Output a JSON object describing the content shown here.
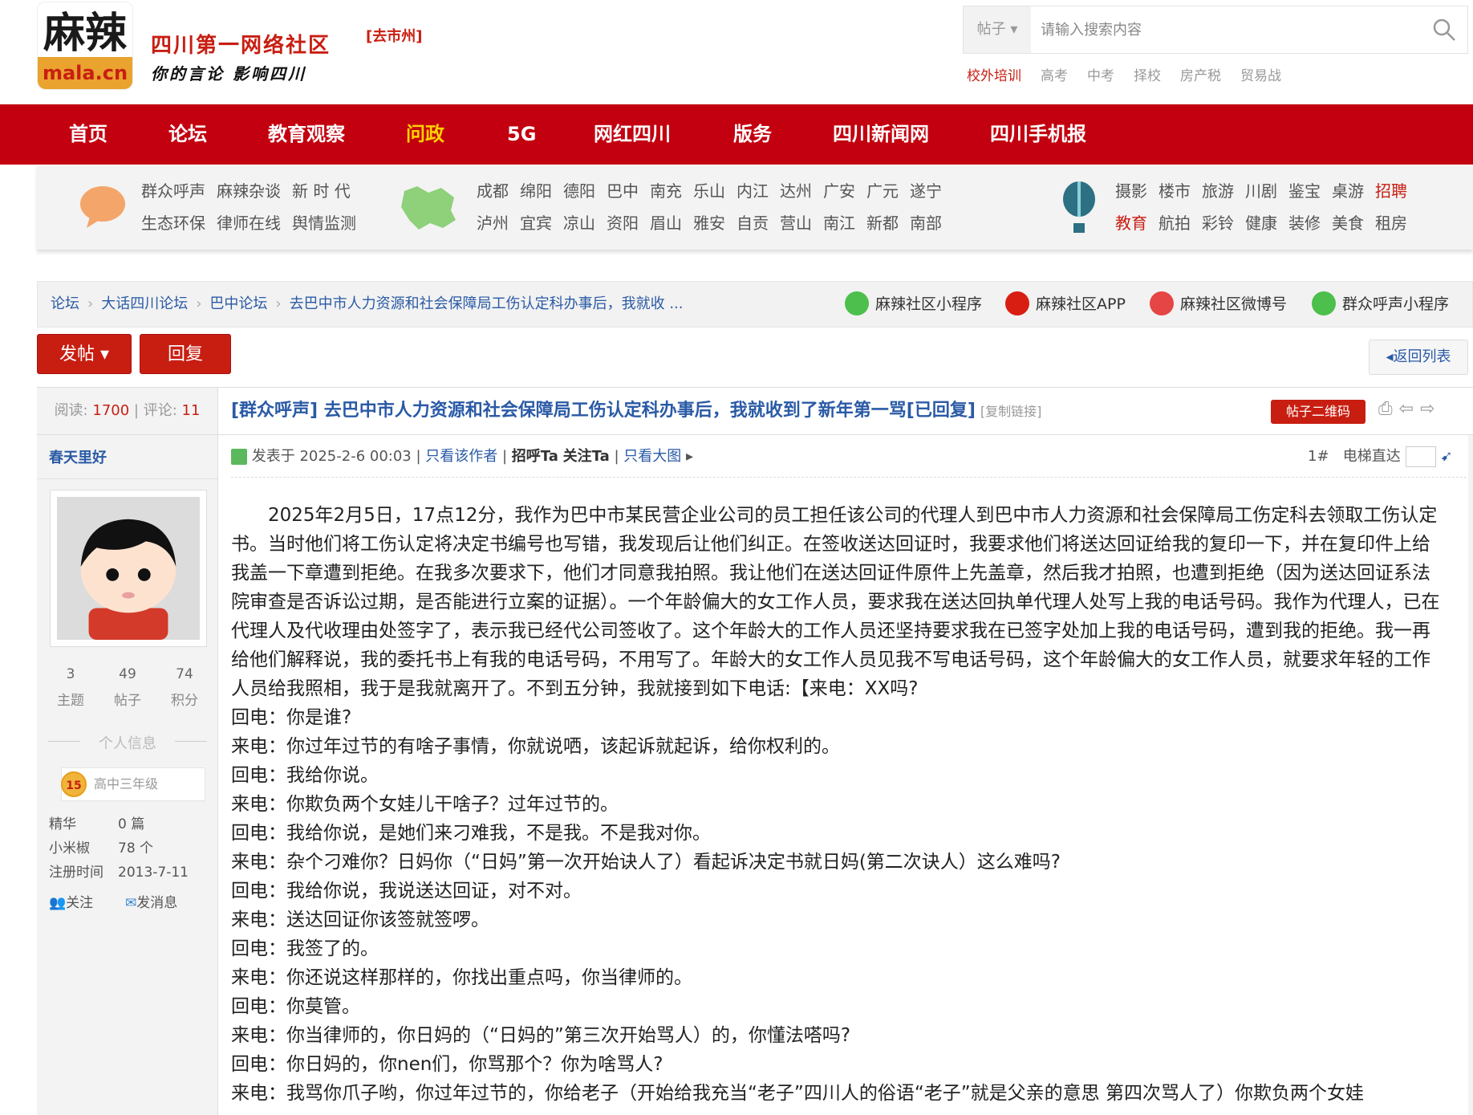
{
  "header": {
    "logo_text": "麻辣",
    "logo_sub": "mala.cn",
    "site_name": "四川第一网络社区",
    "slogan": "你的言论 影响四川",
    "city_link": "[去市州]",
    "search": {
      "type": "帖子",
      "placeholder": "请输入搜索内容"
    },
    "hot_links": [
      "校外培训",
      "高考",
      "中考",
      "择校",
      "房产税",
      "贸易战"
    ]
  },
  "nav": [
    "首页",
    "论坛",
    "教育观察",
    "问政",
    "5G",
    "网红四川",
    "版务",
    "四川新闻网",
    "四川手机报"
  ],
  "nav_active": "问政",
  "categories": {
    "group1_row1": [
      "群众呼声",
      "麻辣杂谈",
      "新 时 代"
    ],
    "group1_row2": [
      "生态环保",
      "律师在线",
      "舆情监测"
    ],
    "group2_row1": [
      "成都",
      "绵阳",
      "德阳",
      "巴中",
      "南充",
      "乐山",
      "内江",
      "达州",
      "广安",
      "广元",
      "遂宁"
    ],
    "group2_row2": [
      "泸州",
      "宜宾",
      "凉山",
      "资阳",
      "眉山",
      "雅安",
      "自贡",
      "营山",
      "南江",
      "新都",
      "南部"
    ],
    "group3_row1": [
      "摄影",
      "楼市",
      "旅游",
      "川剧",
      "鉴宝",
      "桌游",
      "招聘"
    ],
    "group3_row2": [
      "教育",
      "航拍",
      "彩铃",
      "健康",
      "装修",
      "美食",
      "租房"
    ]
  },
  "breadcrumb": [
    "论坛",
    "大话四川论坛",
    "巴中论坛",
    "去巴中市人力资源和社会保障局工伤认定科办事后，我就收 ..."
  ],
  "app_links": [
    "麻辣社区小程序",
    "麻辣社区APP",
    "麻辣社区微博号",
    "群众呼声小程序"
  ],
  "buttons": {
    "post": "发帖",
    "reply": "回复",
    "back": "返回列表",
    "qr": "帖子二维码"
  },
  "thread": {
    "views_label": "阅读:",
    "views": "1700",
    "comments_label": "评论:",
    "comments": "11",
    "title": "[群众呼声] 去巴中市人力资源和社会保障局工伤认定科办事后，我就收到了新年第一骂[已回复]",
    "copy_link": "[复制链接]"
  },
  "author": {
    "name": "春天里好",
    "topics": "3",
    "topics_label": "主题",
    "posts": "49",
    "posts_label": "帖子",
    "points": "74",
    "points_label": "积分",
    "info_title": "个人信息",
    "grade_level": "15",
    "grade_name": "高中三年级",
    "jinghua_label": "精华",
    "jinghua": "0 篇",
    "xiaomijiao_label": "小米椒",
    "xiaomijiao": "78 个",
    "reg_label": "注册时间",
    "reg": "2013-7-11",
    "follow": "关注",
    "message": "发消息"
  },
  "post": {
    "posted_at": "发表于 2025-2-6 00:03",
    "only_author": "只看该作者",
    "greet": "招呼Ta",
    "follow": "关注Ta",
    "big_pic": "只看大图",
    "floor": "1#",
    "jump_label": "电梯直达",
    "paragraphs": [
      "2025年2月5日，17点12分，我作为巴中市某民营企业公司的员工担任该公司的代理人到巴中市人力资源和社会保障局工伤定科去领取工伤认定书。当时他们将工伤认定将决定书编号也写错，我发现后让他们纠正。在签收送达回证时，我要求他们将送达回证给我的复印一下，并在复印件上给我盖一下章遭到拒绝。在我多次要求下，他们才同意我拍照。我让他们在送达回证件原件上先盖章，然后我才拍照，也遭到拒绝（因为送达回证系法院审查是否诉讼过期，是否能进行立案的证据）。一个年龄偏大的女工作人员，要求我在送达回执单代理人处写上我的电话号码。我作为代理人，已在代理人及代收理由处签字了，表示我已经代公司签收了。这个年龄大的工作人员还坚持要求我在已签字处加上我的电话号码，遭到我的拒绝。我一再给他们解释说，我的委托书上有我的电话号码，不用写了。年龄大的女工作人员见我不写电话号码，这个年龄偏大的女工作人员，就要求年轻的工作人员给我照相，我于是我就离开了。不到五分钟，我就接到如下电话:【来电：XX吗?",
      "回电：你是谁?",
      "来电：你过年过节的有啥子事情，你就说哂，该起诉就起诉，给你权利的。",
      "回电：我给你说。",
      "来电：你欺负两个女娃儿干啥子？过年过节的。",
      "回电：我给你说，是她们来刁难我，不是我。不是我对你。",
      "来电：杂个刁难你？日妈你（“日妈”第一次开始诀人了）看起诉决定书就日妈(第二次诀人）这么难吗?",
      "回电：我给你说，我说送达回证，对不对。",
      "来电：送达回证你该签就签啰。",
      "回电：我签了的。",
      "来电：你还说这样那样的，你找出重点吗，你当律师的。",
      "回电：你莫管。",
      "来电：你当律师的，你日妈的（“日妈的”第三次开始骂人）的，你懂法嗒吗?",
      "回电：你日妈的，你nen们，你骂那个？你为啥骂人?",
      "来电：我骂你爪子哟，你过年过节的，你给老子（开始给我充当“老子”四川人的俗语“老子”就是父亲的意思 第四次骂人了）你欺负两个女娃"
    ]
  },
  "colors": {
    "brand_red": "#c3000f",
    "link_blue": "#2a5aa6",
    "nav_active": "#ffd200"
  }
}
